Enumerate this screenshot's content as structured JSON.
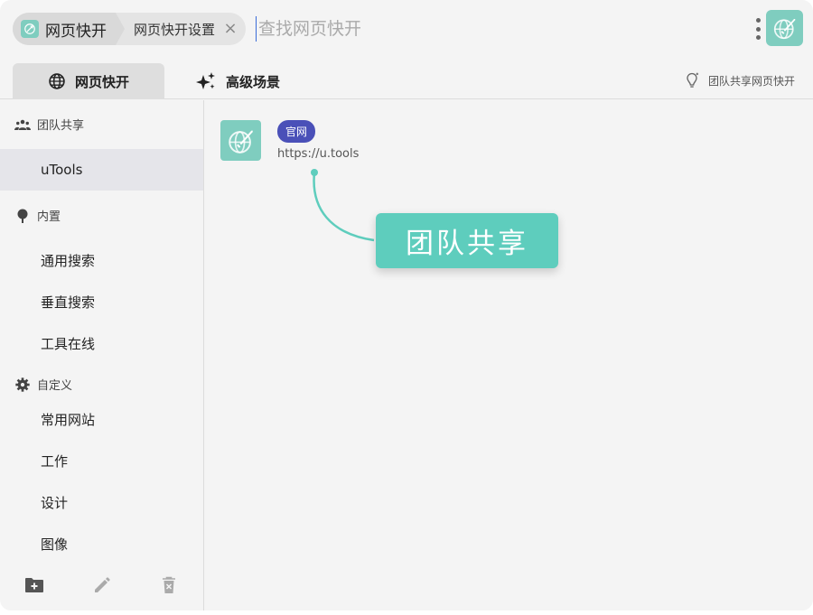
{
  "breadcrumb": {
    "app_name": "网页快开",
    "sub_page": "网页快开设置",
    "close_glyph": "×"
  },
  "search": {
    "placeholder": "查找网页快开",
    "value": ""
  },
  "tabs": [
    {
      "label": "网页快开",
      "icon": "globe-icon",
      "active": true
    },
    {
      "label": "高级场景",
      "icon": "sparkle-icon",
      "active": false
    }
  ],
  "share_link": {
    "label": "团队共享网页快开",
    "icon": "lightbulb-icon"
  },
  "sidebar": {
    "groups": [
      {
        "label": "团队共享",
        "icon": "team-icon",
        "items": [
          {
            "label": "uTools",
            "active": true
          }
        ]
      },
      {
        "label": "内置",
        "icon": "pin-icon",
        "items": [
          {
            "label": "通用搜索"
          },
          {
            "label": "垂直搜索"
          },
          {
            "label": "工具在线"
          }
        ]
      },
      {
        "label": "自定义",
        "icon": "gear-icon",
        "items": [
          {
            "label": "常用网站"
          },
          {
            "label": "工作"
          },
          {
            "label": "设计"
          },
          {
            "label": "图像"
          }
        ]
      }
    ],
    "actions": [
      "add-folder-icon",
      "edit-icon",
      "delete-icon"
    ]
  },
  "entries": [
    {
      "badge": "官网",
      "url": "https://u.tools",
      "icon": "rocket-globe-icon"
    }
  ],
  "callout": {
    "text": "团队共享"
  },
  "colors": {
    "accent_teal": "#5ecdbd",
    "icon_teal": "#7fcdbf",
    "badge_indigo": "#4a50b8",
    "caret_blue": "#3a6bd8"
  }
}
